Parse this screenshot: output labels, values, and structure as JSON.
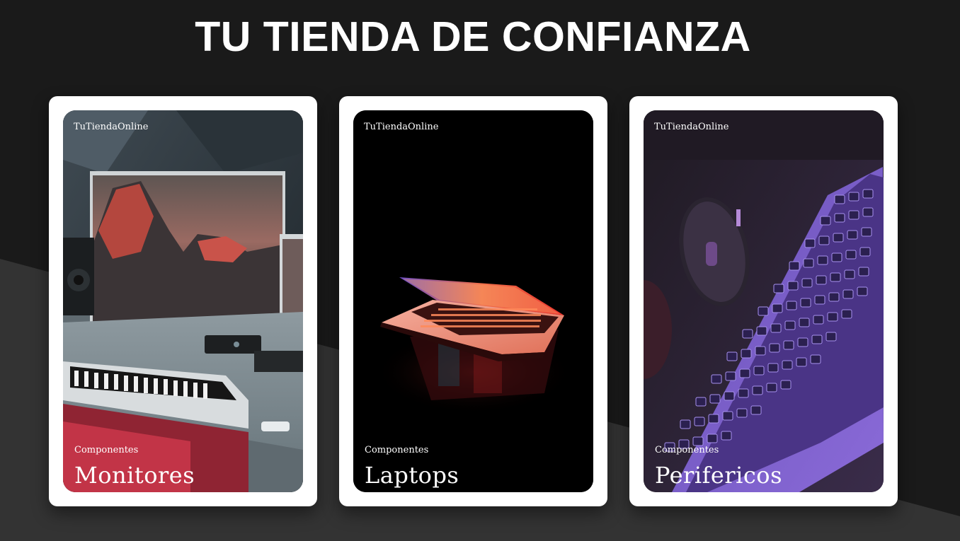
{
  "header": {
    "title": "TU TIENDA DE CONFIANZA"
  },
  "colors": {
    "background": "#1a1a1a",
    "slant": "#333333",
    "card": "#ffffff",
    "text": "#ffffff"
  },
  "cards": [
    {
      "brand": "TuTiendaOnline",
      "category": "Componentes",
      "name": "Monitores",
      "image": "monitor-studio-image"
    },
    {
      "brand": "TuTiendaOnline",
      "category": "Componentes",
      "name": "Laptops",
      "image": "laptop-glow-image"
    },
    {
      "brand": "TuTiendaOnline",
      "category": "Componentes",
      "name": "Perifericos",
      "image": "keyboard-mouse-image"
    }
  ]
}
